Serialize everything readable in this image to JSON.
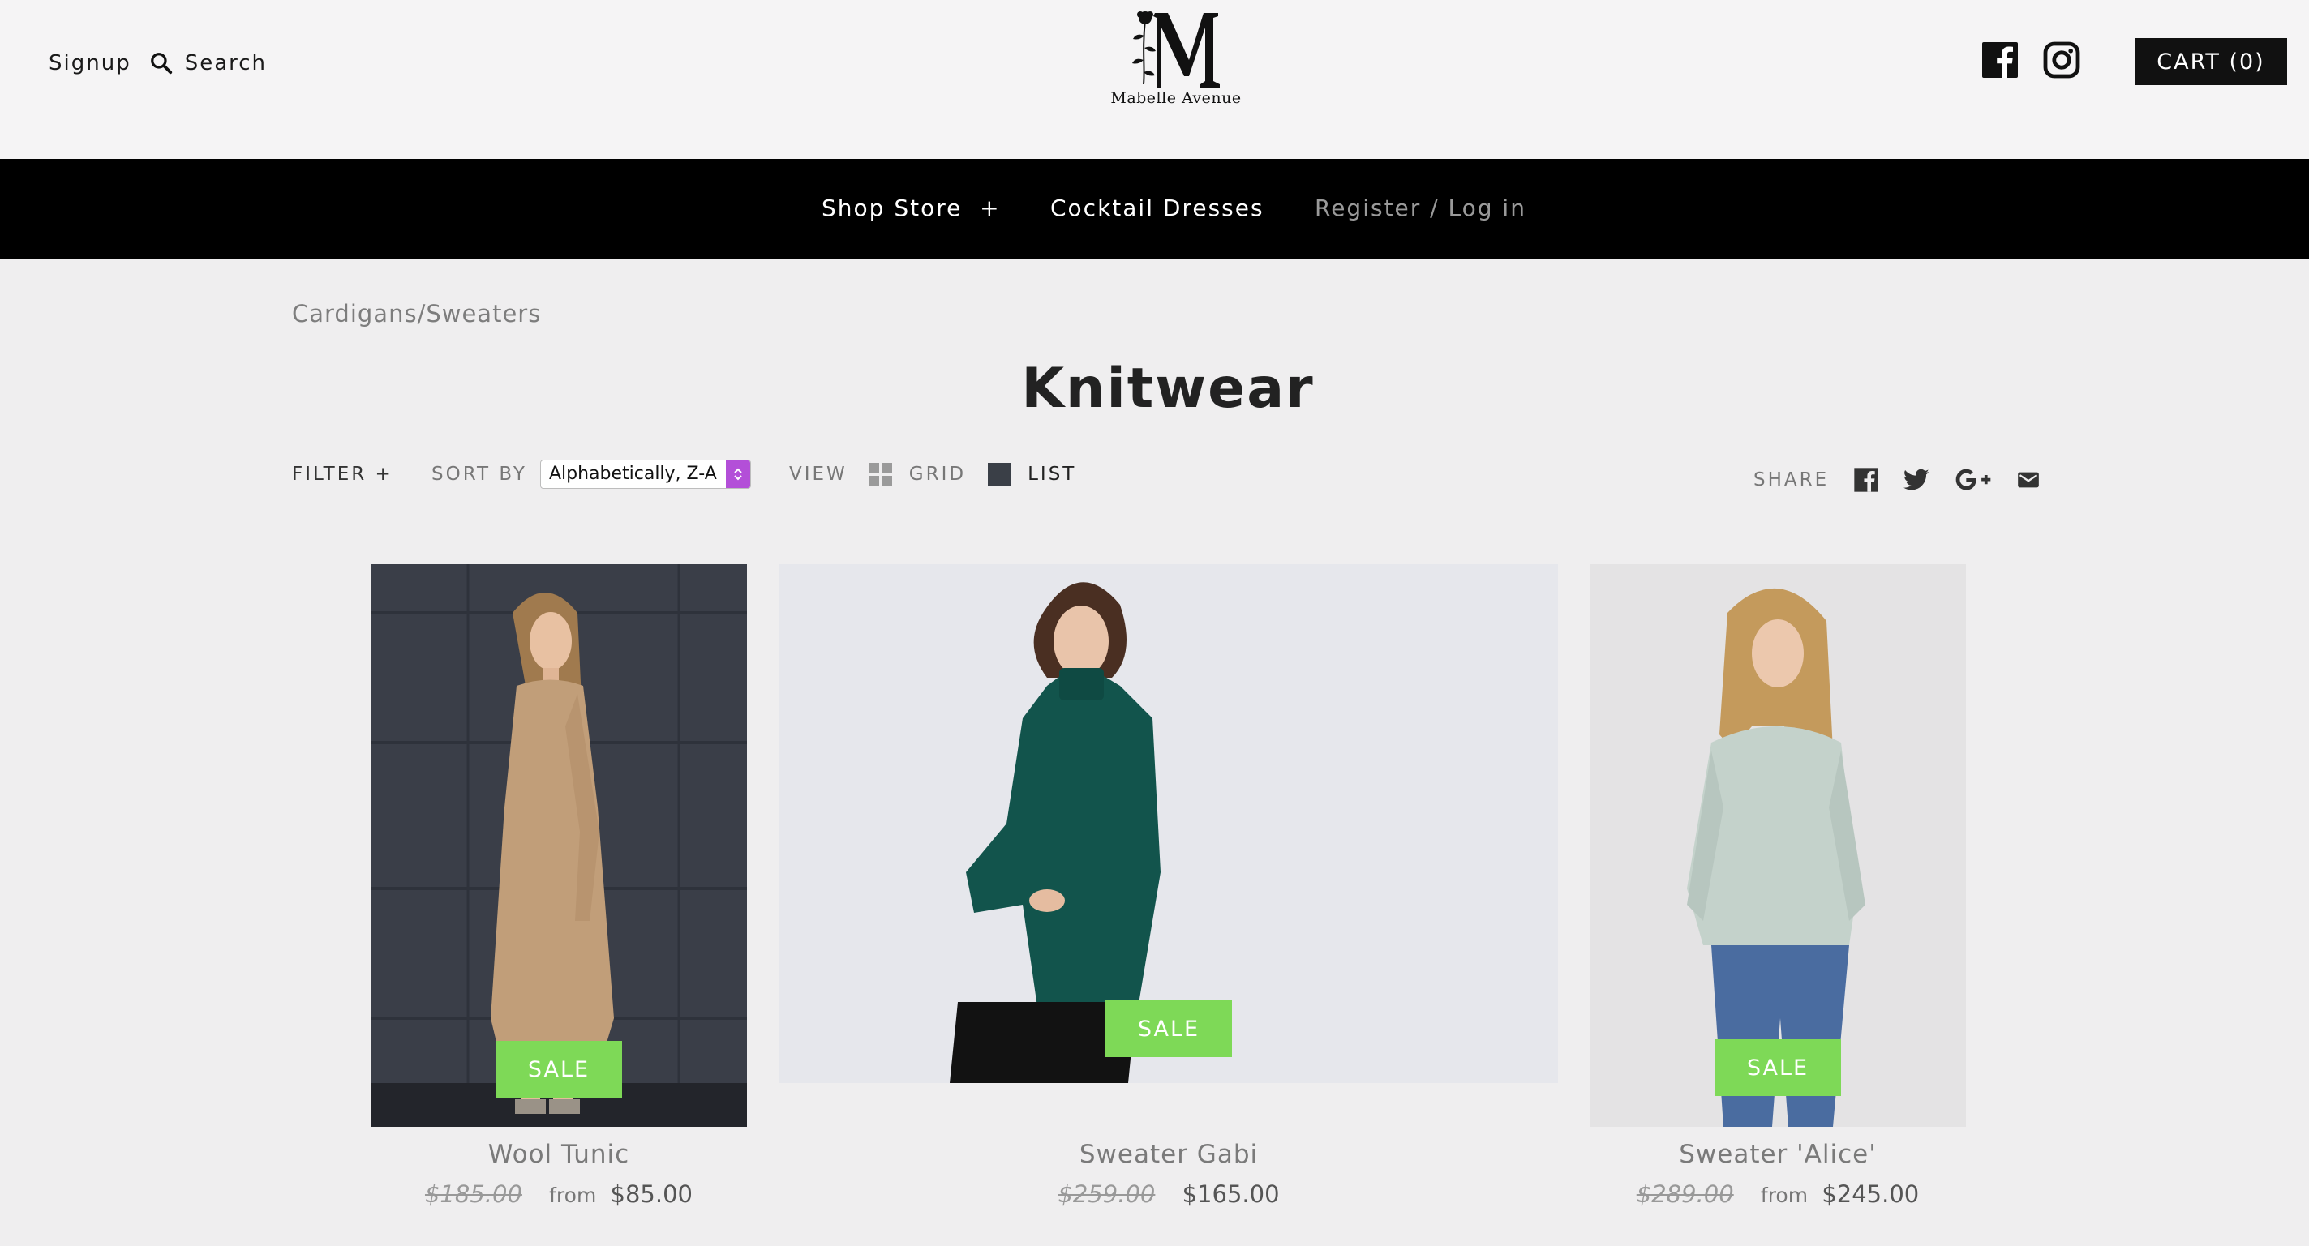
{
  "header": {
    "signup": "Signup",
    "search": "Search",
    "logo_text": "Mabelle Avenue",
    "cart": "CART (0)"
  },
  "nav": {
    "items": [
      {
        "label": "Shop Store  +"
      },
      {
        "label": "Cocktail Dresses"
      },
      {
        "label": "Register / Log in"
      }
    ]
  },
  "breadcrumb": "Cardigans/Sweaters",
  "page_title": "Knitwear",
  "toolbar": {
    "filter": "FILTER +",
    "sort_by": "SORT BY",
    "sort_value": "Alphabetically, Z-A",
    "view": "VIEW",
    "grid": "GRID",
    "list": "LIST",
    "share": "SHARE"
  },
  "products": [
    {
      "name": "Wool Tunic",
      "old_price": "$185.00",
      "from": "from",
      "price": "$85.00",
      "badge": "SALE"
    },
    {
      "name": "Sweater Gabi",
      "old_price": "$259.00",
      "from": "",
      "price": "$165.00",
      "badge": "SALE"
    },
    {
      "name": "Sweater 'Alice'",
      "old_price": "$289.00",
      "from": "from",
      "price": "$245.00",
      "badge": "SALE"
    }
  ],
  "colors": {
    "sale_badge": "#7ed957",
    "nav_bg": "#000000",
    "page_bg": "#efeeef",
    "sort_accent": "#b34fd8"
  },
  "icons": [
    "search-icon",
    "facebook-icon",
    "instagram-icon",
    "grid-icon",
    "list-icon",
    "twitter-icon",
    "google-plus-icon",
    "email-icon"
  ]
}
